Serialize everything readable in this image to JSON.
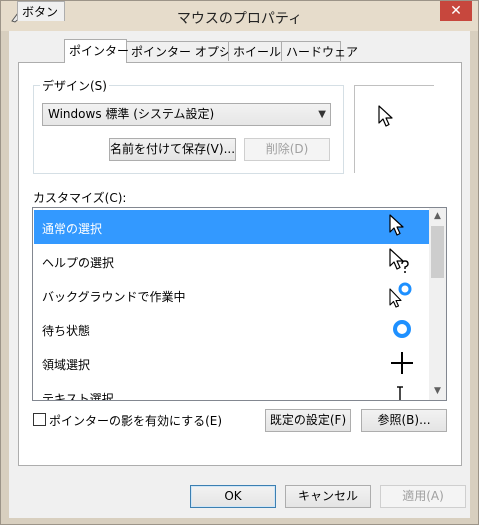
{
  "window": {
    "title": "マウスのプロパティ",
    "close_glyph": "✕"
  },
  "tabs": [
    {
      "label": "ボタン",
      "active": false
    },
    {
      "label": "ポインター",
      "active": true
    },
    {
      "label": "ポインター オプション",
      "active": false
    },
    {
      "label": "ホイール",
      "active": false
    },
    {
      "label": "ハードウェア",
      "active": false
    }
  ],
  "design": {
    "label": "デザイン(S)",
    "scheme_value": "Windows 標準 (システム設定)",
    "save_as_label": "名前を付けて保存(V)...",
    "delete_label": "削除(D)"
  },
  "customize": {
    "label": "カスタマイズ(C):",
    "items": [
      {
        "label": "通常の選択",
        "icon": "arrow-cursor-icon",
        "selected": true
      },
      {
        "label": "ヘルプの選択",
        "icon": "help-cursor-icon",
        "selected": false
      },
      {
        "label": "バックグラウンドで作業中",
        "icon": "working-in-background-cursor-icon",
        "selected": false
      },
      {
        "label": "待ち状態",
        "icon": "busy-cursor-icon",
        "selected": false
      },
      {
        "label": "領域選択",
        "icon": "crosshair-cursor-icon",
        "selected": false
      },
      {
        "label": "テキスト選択",
        "icon": "text-beam-cursor-icon",
        "selected": false
      }
    ]
  },
  "options": {
    "shadow_checkbox_label": "ポインターの影を有効にする(E)",
    "shadow_checked": false,
    "use_default_label": "既定の設定(F)",
    "browse_label": "参照(B)..."
  },
  "footer": {
    "ok_label": "OK",
    "cancel_label": "キャンセル",
    "apply_label": "適用(A)"
  },
  "colors": {
    "selection": "#3399ff",
    "busy_ring": "#1e90ff",
    "close_button": "#c7473d"
  }
}
